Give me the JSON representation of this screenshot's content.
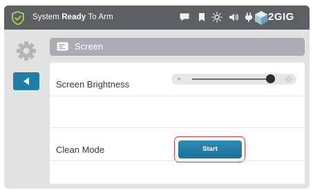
{
  "status_bar": {
    "prefix": "System ",
    "state": "Ready",
    "suffix": " To Arm",
    "icons": [
      "message-icon",
      "bookmark-icon",
      "brightness-icon",
      "volume-icon",
      "power-plug-icon"
    ],
    "brand": "2GIG",
    "bg_color": "#5d6063"
  },
  "sidebar": {
    "settings_icon": "gear-icon",
    "back_icon": "back-arrow-icon",
    "back_color": "#1f7ea6"
  },
  "header": {
    "icon": "screen-icon",
    "title": "Screen"
  },
  "settings": {
    "brightness": {
      "label": "Screen Brightness",
      "level": 0.95
    },
    "clean_mode": {
      "label": "Clean Mode",
      "button": "Start"
    }
  },
  "colors": {
    "accent": "#1f7ea6",
    "highlight": "#cc3b3f",
    "panel_bg": "#e2e2e3"
  }
}
